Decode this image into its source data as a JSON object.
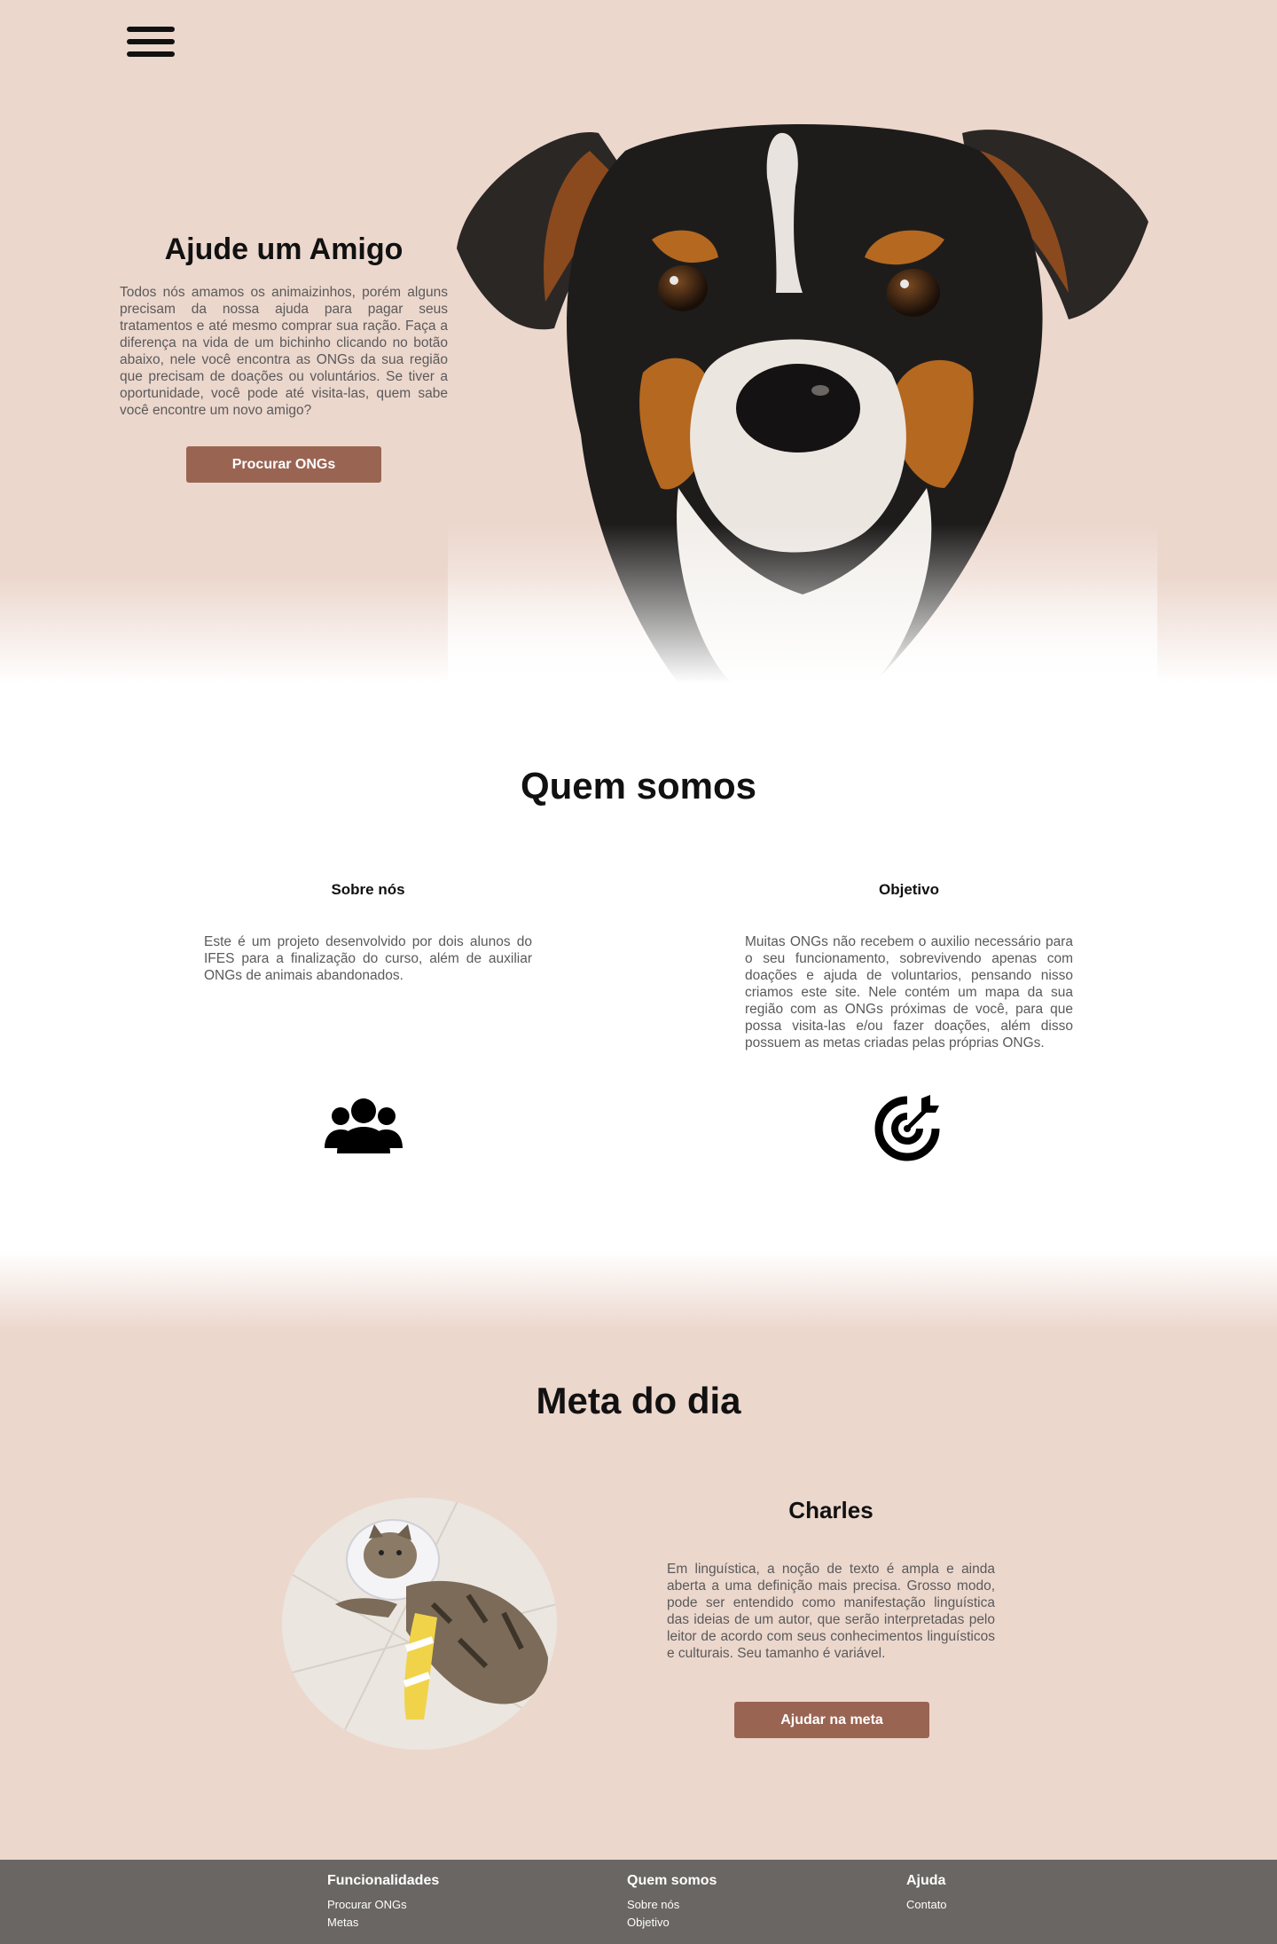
{
  "hero": {
    "title": "Ajude um Amigo",
    "text": "Todos nós amamos os animaizinhos, porém alguns precisam da nossa ajuda para pagar seus tratamentos e até mesmo comprar sua ração. Faça a diferença na vida de um bichinho clicando no botão abaixo, nele você encontra as ONGs  da sua região que precisam de doações ou voluntários. Se tiver a oportunidade, você pode até visita-las, quem sabe você encontre um novo amigo?",
    "button_label": "Procurar ONGs"
  },
  "quem_somos": {
    "title": "Quem somos",
    "sobre": {
      "title": "Sobre nós",
      "text": "Este é um projeto desenvolvido por dois alunos do IFES para a finalização do curso, além de auxiliar ONGs de animais abandonados.",
      "icon": "users-icon"
    },
    "objetivo": {
      "title": "Objetivo",
      "text": "Muitas ONGs não recebem o auxilio necessário para o seu funcionamento, sobrevivendo apenas com doações e ajuda de voluntarios, pensando nisso criamos este site. Nele contém um mapa da sua região com as ONGs próximas de você, para que possa visita-las e/ou fazer doações, além disso possuem as metas criadas pelas próprias ONGs.",
      "icon": "target-icon"
    }
  },
  "meta": {
    "title": "Meta do dia",
    "animal_name": "Charles",
    "text": "Em linguística, a noção de texto é ampla e ainda aberta a uma definição mais precisa. Grosso modo, pode ser entendido como manifestação linguística das ideias de um autor, que serão interpretadas pelo leitor de acordo com seus conhecimentos linguísticos e culturais. Seu tamanho é variável.",
    "button_label": "Ajudar na meta"
  },
  "footer": {
    "cols": [
      {
        "title": "Funcionalidades",
        "links": [
          "Procurar ONGs",
          "Metas"
        ]
      },
      {
        "title": "Quem somos",
        "links": [
          "Sobre nós",
          "Objetivo"
        ]
      },
      {
        "title": "Ajuda",
        "links": [
          "Contato"
        ]
      }
    ]
  },
  "colors": {
    "accent": "#9a6453",
    "background_pink": "#ecd7cd",
    "footer": "#696663"
  }
}
